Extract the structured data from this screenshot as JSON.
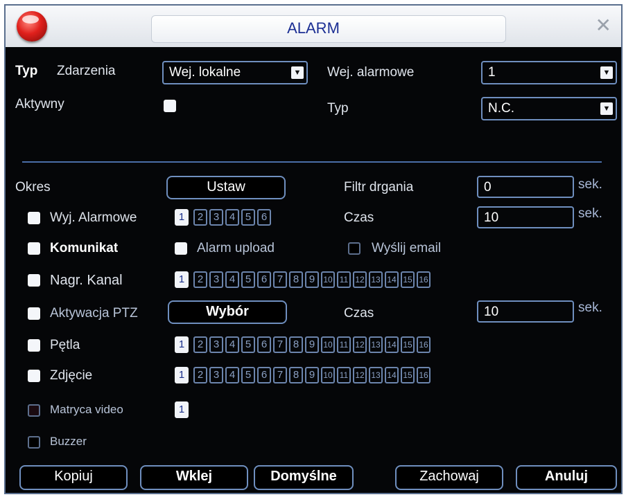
{
  "window": {
    "title": "ALARM",
    "close_symbol": "✕"
  },
  "top": {
    "typ_label": "Typ",
    "zdarzenia_label": "Zdarzenia",
    "event_type_value": "Wej. lokalne",
    "alarm_input_label": "Wej. alarmowe",
    "alarm_input_value": "1",
    "aktywny_label": "Aktywny",
    "aktywny_checked": true,
    "typ2_label": "Typ",
    "typ2_value": "N.C."
  },
  "okres": {
    "label": "Okres",
    "button": "Ustaw"
  },
  "filtr": {
    "label": "Filtr drgania",
    "value": "0",
    "unit": "sek."
  },
  "wyj": {
    "label": "Wyj. Alarmowe",
    "nums": [
      "1",
      "2",
      "3",
      "4",
      "5",
      "6"
    ],
    "selected": [
      "1"
    ]
  },
  "czas1": {
    "label": "Czas",
    "value": "10",
    "unit": "sek."
  },
  "komunikat": {
    "label": "Komunikat"
  },
  "upload": {
    "label": "Alarm upload"
  },
  "email": {
    "label": "Wyślij email"
  },
  "nagr": {
    "label": "Nagr. Kanal",
    "nums": [
      "1",
      "2",
      "3",
      "4",
      "5",
      "6",
      "7",
      "8",
      "9",
      "10",
      "11",
      "12",
      "13",
      "14",
      "15",
      "16"
    ],
    "selected": [
      "1"
    ]
  },
  "ptz": {
    "label": "Aktywacja PTZ",
    "button": "Wybór"
  },
  "czas2": {
    "label": "Czas",
    "value": "10",
    "unit": "sek."
  },
  "petla": {
    "label": "Pętla",
    "nums": [
      "1",
      "2",
      "3",
      "4",
      "5",
      "6",
      "7",
      "8",
      "9",
      "10",
      "11",
      "12",
      "13",
      "14",
      "15",
      "16"
    ],
    "selected": [
      "1"
    ]
  },
  "zdjecie": {
    "label": "Zdjęcie",
    "nums": [
      "1",
      "2",
      "3",
      "4",
      "5",
      "6",
      "7",
      "8",
      "9",
      "10",
      "11",
      "12",
      "13",
      "14",
      "15",
      "16"
    ],
    "selected": [
      "1"
    ]
  },
  "matryca": {
    "label": "Matryca video",
    "nums": [
      "1"
    ],
    "selected": [
      "1"
    ]
  },
  "buzzer": {
    "label": "Buzzer"
  },
  "buttons": {
    "copy": "Kopiuj",
    "paste": "Wklej",
    "defaults": "Domyślne",
    "save": "Zachowaj",
    "cancel": "Anuluj"
  },
  "colors": {
    "background": "#050608",
    "border": "#6f8fbf",
    "title": "#1c2f94"
  },
  "icons": {
    "logo": "red-sphere-icon",
    "close": "close-icon",
    "dropdown": "dropdown-arrow-icon"
  }
}
